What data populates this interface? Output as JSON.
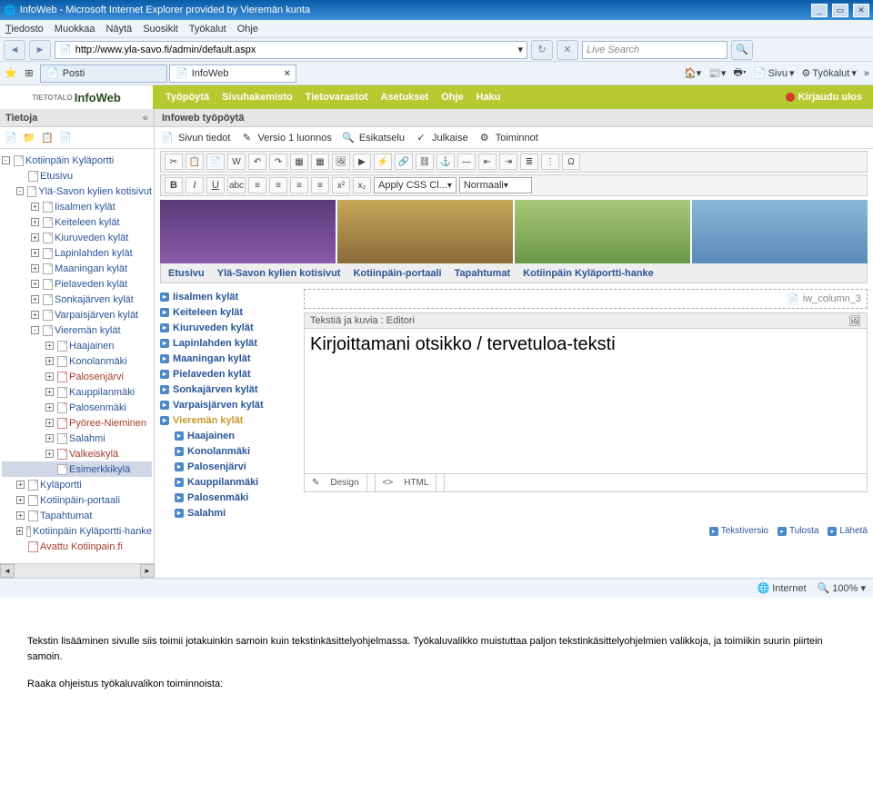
{
  "window": {
    "title": "InfoWeb - Microsoft Internet Explorer provided by Vieremän kunta"
  },
  "menubar": [
    "Tiedosto",
    "Muokkaa",
    "Näytä",
    "Suosikit",
    "Työkalut",
    "Ohje"
  ],
  "address": {
    "url": "http://www.yla-savo.fi/admin/default.aspx"
  },
  "search": {
    "placeholder": "Live Search"
  },
  "ie_tabs": [
    {
      "label": "Posti"
    },
    {
      "label": "InfoWeb",
      "active": true
    }
  ],
  "ie_right": [
    "Sivu",
    "Työkalut"
  ],
  "logo": {
    "small": "TIETOTALO",
    "big": "InfoWeb"
  },
  "app_nav": [
    "Työpöytä",
    "Sivuhakemisto",
    "Tietovarastot",
    "Asetukset",
    "Ohje",
    "Haku"
  ],
  "logout": "Kirjaudu ulos",
  "left_panel_title": "Tietoja",
  "right_panel_title": "Infoweb työpöytä",
  "rp_toolbar": [
    "Sivun tiedot",
    "Versio 1 luonnos",
    "Esikatselu",
    "Julkaise",
    "Toiminnot"
  ],
  "tree": [
    {
      "t": "Kotiinpäin Kyläportti",
      "lvl": 0,
      "box": "-"
    },
    {
      "t": "Etusivu",
      "lvl": 1
    },
    {
      "t": "Ylä-Savon kylien kotisivut",
      "lvl": 1,
      "box": "-"
    },
    {
      "t": "Iisalmen kylät",
      "lvl": 2,
      "box": "+"
    },
    {
      "t": "Keiteleen kylät",
      "lvl": 2,
      "box": "+"
    },
    {
      "t": "Kiuruveden kylät",
      "lvl": 2,
      "box": "+"
    },
    {
      "t": "Lapinlahden kylät",
      "lvl": 2,
      "box": "+"
    },
    {
      "t": "Maaningan kylät",
      "lvl": 2,
      "box": "+"
    },
    {
      "t": "Pielaveden kylät",
      "lvl": 2,
      "box": "+"
    },
    {
      "t": "Sonkajärven kylät",
      "lvl": 2,
      "box": "+"
    },
    {
      "t": "Varpaisjärven kylät",
      "lvl": 2,
      "box": "+"
    },
    {
      "t": "Vieremän kylät",
      "lvl": 2,
      "box": "-"
    },
    {
      "t": "Haajainen",
      "lvl": 3,
      "box": "+"
    },
    {
      "t": "Konolanmäki",
      "lvl": 3,
      "box": "+"
    },
    {
      "t": "Palosenjärvi",
      "lvl": 3,
      "box": "+",
      "red": true
    },
    {
      "t": "Kauppilanmäki",
      "lvl": 3,
      "box": "+"
    },
    {
      "t": "Palosenmäki",
      "lvl": 3,
      "box": "+"
    },
    {
      "t": "Pyöree-Nieminen",
      "lvl": 3,
      "box": "+",
      "red": true
    },
    {
      "t": "Salahmi",
      "lvl": 3,
      "box": "+"
    },
    {
      "t": "Valkeiskylä",
      "lvl": 3,
      "box": "+",
      "red": true
    },
    {
      "t": "Esimerkkikylä",
      "lvl": 3,
      "sel": true
    },
    {
      "t": "Kyläportti",
      "lvl": 1,
      "box": "+"
    },
    {
      "t": "Kotiinpäin-portaali",
      "lvl": 1,
      "box": "+"
    },
    {
      "t": "Tapahtumat",
      "lvl": 1,
      "box": "+"
    },
    {
      "t": "Kotiinpäin Kyläportti-hanke",
      "lvl": 1,
      "box": "+"
    },
    {
      "t": "Avattu Kotiinpain.fi",
      "lvl": 1,
      "red": true
    }
  ],
  "editor_bar2": {
    "css": "Apply CSS Cl...",
    "style": "Normaali"
  },
  "page_tabs": [
    "Etusivu",
    "Ylä-Savon kylien kotisivut",
    "Kotiinpäin-portaali",
    "Tapahtumat",
    "Kotiinpäin Kyläportti-hanke"
  ],
  "sub_nav": [
    {
      "t": "Iisalmen kylät"
    },
    {
      "t": "Keiteleen kylät"
    },
    {
      "t": "Kiuruveden kylät"
    },
    {
      "t": "Lapinlahden kylät"
    },
    {
      "t": "Maaningan kylät"
    },
    {
      "t": "Pielaveden kylät"
    },
    {
      "t": "Sonkajärven kylät"
    },
    {
      "t": "Varpaisjärven kylät"
    },
    {
      "t": "Vieremän kylät",
      "hl": true
    },
    {
      "t": "Haajainen",
      "sub": true
    },
    {
      "t": "Konolanmäki",
      "sub": true
    },
    {
      "t": "Palosenjärvi",
      "sub": true
    },
    {
      "t": "Kauppilanmäki",
      "sub": true
    },
    {
      "t": "Palosenmäki",
      "sub": true
    },
    {
      "t": "Salahmi",
      "sub": true
    }
  ],
  "col_placeholder": "iw_column_3",
  "editor_head": "Tekstiä ja kuvia : Editori",
  "editor_title": "Kirjoittamani otsikko / tervetuloa-teksti",
  "editor_foot": {
    "design": "Design",
    "html": "HTML"
  },
  "page_actions": [
    "Tekstiversio",
    "Tulosta",
    "Lähetä"
  ],
  "statusbar": {
    "zone": "Internet",
    "zoom": "100%"
  },
  "doc": {
    "p1": "Tekstin lisääminen sivulle siis toimii jotakuinkin samoin kuin tekstinkäsittelyohjelmassa. Työkaluvalikko muistuttaa paljon tekstinkäsittelyohjelmien valikkoja, ja toimiikin suurin piirtein samoin.",
    "p2": "Raaka ohjeistus työkaluvalikon toiminnoista:"
  }
}
